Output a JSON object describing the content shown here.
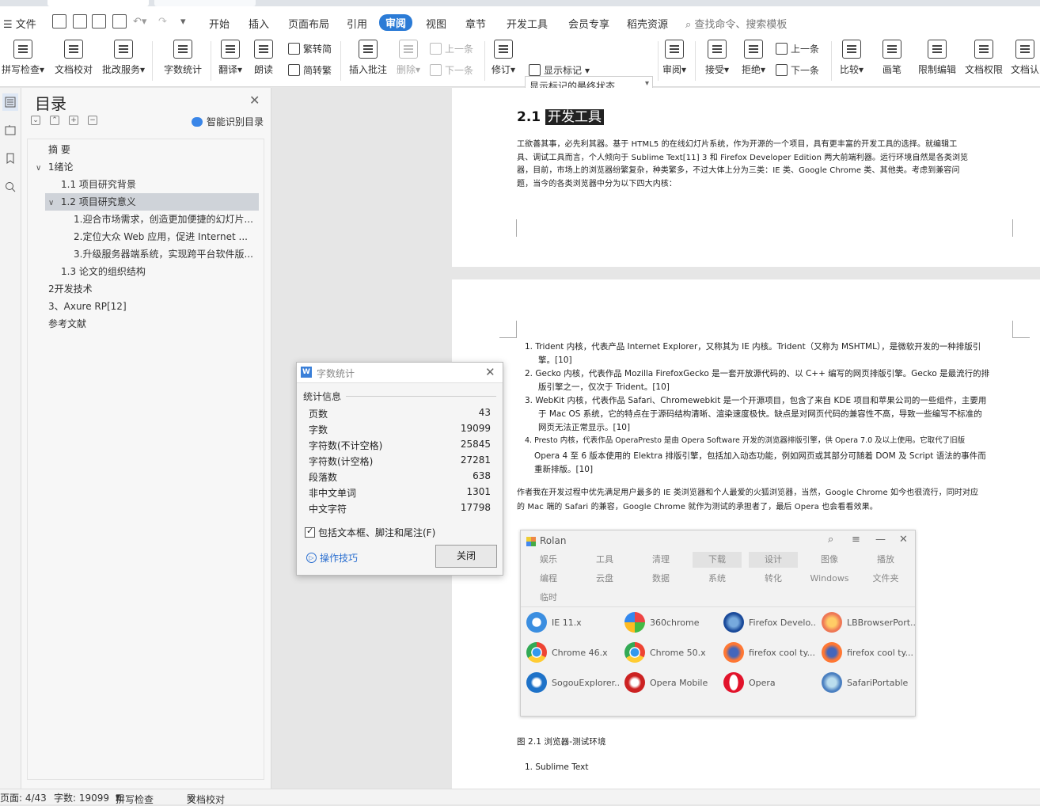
{
  "menubar": {
    "file": "文件",
    "tabs": [
      "开始",
      "插入",
      "页面布局",
      "引用",
      "审阅",
      "视图",
      "章节",
      "开发工具",
      "会员专享",
      "稻壳资源"
    ],
    "active_tab": "审阅",
    "search": "查找命令、搜索模板"
  },
  "ribbon": {
    "spell": "拼写检查",
    "doc_check": "文档校对",
    "correct": "批改服务",
    "wordcount": "字数统计",
    "translate": "翻译",
    "read": "朗读",
    "to_trad": "繁转简",
    "to_simp": "简转繁",
    "insert_comment": "插入批注",
    "delete": "删除",
    "prev": "上一条",
    "next": "下一条",
    "revise": "修订",
    "markup_select": "显示标记的最终状态",
    "show_markup": "显示标记",
    "review": "审阅",
    "accept": "接受",
    "reject": "拒绝",
    "prev2": "上一条",
    "next2": "下一条",
    "compare": "比较",
    "pen": "画笔",
    "restrict_edit": "限制编辑",
    "doc_perm": "文档权限",
    "doc_cert": "文档认"
  },
  "toc": {
    "title": "目录",
    "smart": "智能识别目录",
    "items": [
      {
        "text": "摘 要"
      },
      {
        "text": "1绪论"
      },
      {
        "text": "1.1 项目研究背景"
      },
      {
        "text": "1.2 项目研究意义"
      },
      {
        "text": "1.迎合市场需求，创造更加便捷的幻灯片..."
      },
      {
        "text": "2.定位大众 Web 应用，促进 Internet ..."
      },
      {
        "text": "3.升级服务器端系统，实现跨平台软件版..."
      },
      {
        "text": "1.3 论文的组织结构"
      },
      {
        "text": "2开发技术"
      },
      {
        "text": "3、Axure RP[12]"
      },
      {
        "text": "参考文献"
      }
    ]
  },
  "doc": {
    "heading_num": "2.1",
    "heading_text": "开发工具",
    "para1": [
      "工欲善其事，必先利其器。基于 HTML5 的在线幻灯片系统，作为开源的一个项目，具有更丰富的开发工具的选择。就编辑工",
      "具、调试工具而言，个人倾向于 Sublime Text[11] 3 和 Firefox Developer Edition 两大前端利器。运行环境自然是各类浏览",
      "器，目前，市场上的浏览器纷繁复杂，种类繁多，不过大体上分为三类：IE 类、Google Chrome 类、其他类。考虑到兼容问",
      "题，当今的各类浏览器中分为以下四大内核："
    ],
    "li1": [
      "1.  Trident 内核，代表产品 Internet Explorer，又称其为 IE 内核。Trident（又称为 MSHTML），是微软开发的一种排版引",
      "擎。[10]"
    ],
    "li2": [
      "2.  Gecko 内核，代表作品 Mozilla FirefoxGecko 是一套开放源代码的、以 C++ 编写的网页排版引擎。Gecko 是最流行的排",
      "版引擎之一，仅次于 Trident。[10]"
    ],
    "li3": [
      "3.  WebKit 内核，代表作品 Safari、Chromewebkit 是一个开源项目，包含了来自 KDE 项目和苹果公司的一些组件，主要用",
      "于 Mac OS 系统，它的特点在于源码结构清晰、渲染速度极快。缺点是对网页代码的兼容性不高，导致一些编写不标准的",
      "网页无法正常显示。[10]"
    ],
    "li4": [
      "4.  Presto 内核，代表作品 OperaPresto 是由 Opera Software 开发的浏览器排版引擎，供 Opera 7.0 及以上使用。它取代了旧版",
      "Opera 4 至 6 版本使用的 Elektra 排版引擎，包括加入动态功能，例如网页或其部分可随着 DOM 及 Script 语法的事件而",
      "重新排版。[10]"
    ],
    "para2": [
      "作者我在开发过程中优先满足用户最多的 IE 类浏览器和个人最爱的火狐浏览器，当然，Google Chrome 如今也很流行，同时对应",
      "的 Mac 端的 Safari 的兼容，Google Chrome 就作为测试的承担者了，最后 Opera 也会看看效果。"
    ],
    "caption": "图 2.1 浏览器-测试环境",
    "li5": "1.  Sublime Text"
  },
  "rolan": {
    "title": "Rolan",
    "cats": [
      "娱乐",
      "工具",
      "清理",
      "下载",
      "设计",
      "图像",
      "播放",
      "编程",
      "云盘",
      "数据",
      "系统",
      "转化",
      "Windows",
      "文件夹",
      "临时"
    ],
    "apps": [
      "IE 11.x",
      "360chrome",
      "Firefox Develo...",
      "LBBrowserPort...",
      "Chrome 46.x",
      "Chrome 50.x",
      "firefox cool ty...",
      "firefox cool ty...",
      "SogouExplorer...",
      "Opera Mobile",
      "Opera",
      "SafariPortable"
    ]
  },
  "wordcount": {
    "title": "字数统计",
    "group": "统计信息",
    "rows": [
      {
        "label": "页数",
        "value": "43"
      },
      {
        "label": "字数",
        "value": "19099"
      },
      {
        "label": "字符数(不计空格)",
        "value": "25845"
      },
      {
        "label": "字符数(计空格)",
        "value": "27281"
      },
      {
        "label": "段落数",
        "value": "638"
      },
      {
        "label": "非中文单词",
        "value": "1301"
      },
      {
        "label": "中文字符",
        "value": "17798"
      }
    ],
    "include": "包括文本框、脚注和尾注(F)",
    "tips": "操作技巧",
    "close": "关闭"
  },
  "status": {
    "page": "页面: 4/43",
    "words": "字数: 19099",
    "spell": "拼写检查",
    "doccheck": "文档校对"
  }
}
